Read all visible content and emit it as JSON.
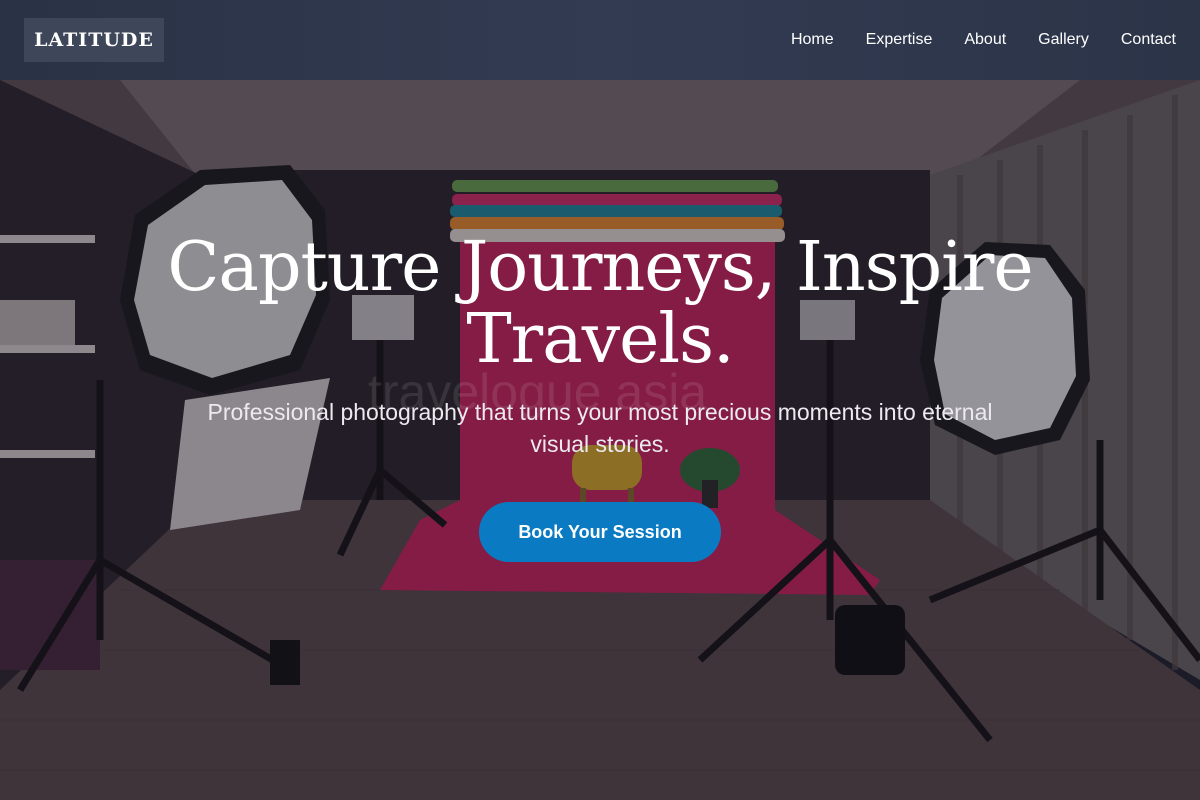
{
  "header": {
    "logo": "LATITUDE",
    "nav": [
      {
        "label": "Home"
      },
      {
        "label": "Expertise"
      },
      {
        "label": "About"
      },
      {
        "label": "Gallery"
      },
      {
        "label": "Contact"
      }
    ]
  },
  "hero": {
    "title": "Capture Journeys, Inspire Travels.",
    "subtitle": "Professional photography that turns your most precious moments into eternal visual stories.",
    "cta_label": "Book Your Session",
    "watermark": "travelogue asia"
  },
  "colors": {
    "header_bg": "#2c3448",
    "logo_bg": "#3e4759",
    "cta_bg": "#0a7bc2",
    "backdrop_magenta": "#c8235e"
  }
}
